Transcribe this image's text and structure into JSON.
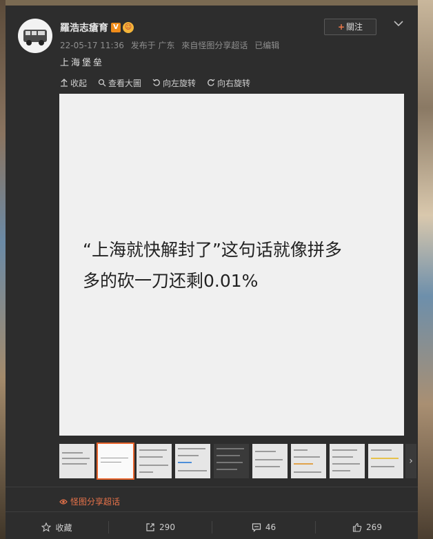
{
  "post": {
    "username": "羅浩志瘡育",
    "vip_badge": "V",
    "timestamp": "22-05-17 11:36",
    "location": "发布于 广东",
    "source": "來自怪图分享超话",
    "edited": "已编辑",
    "text": "上海堡垒",
    "follow_label": "關注",
    "follow_plus": "+"
  },
  "toolbar": {
    "collect": "收起",
    "view_large": "查看大圖",
    "rotate_left": "向左旋转",
    "rotate_right": "向右旋转"
  },
  "image": {
    "line1": "“上海就快解封了”这句话就像拼多",
    "line2": "多的砍一刀还剩0.01%"
  },
  "supertopic": {
    "label": "怪图分享超话"
  },
  "footer": {
    "favorite": "收藏",
    "repost_count": "290",
    "comment_count": "46",
    "like_count": "269"
  },
  "colors": {
    "card_bg": "#2d2d2d",
    "accent": "#e8632b",
    "supertopic": "#e8734a"
  }
}
